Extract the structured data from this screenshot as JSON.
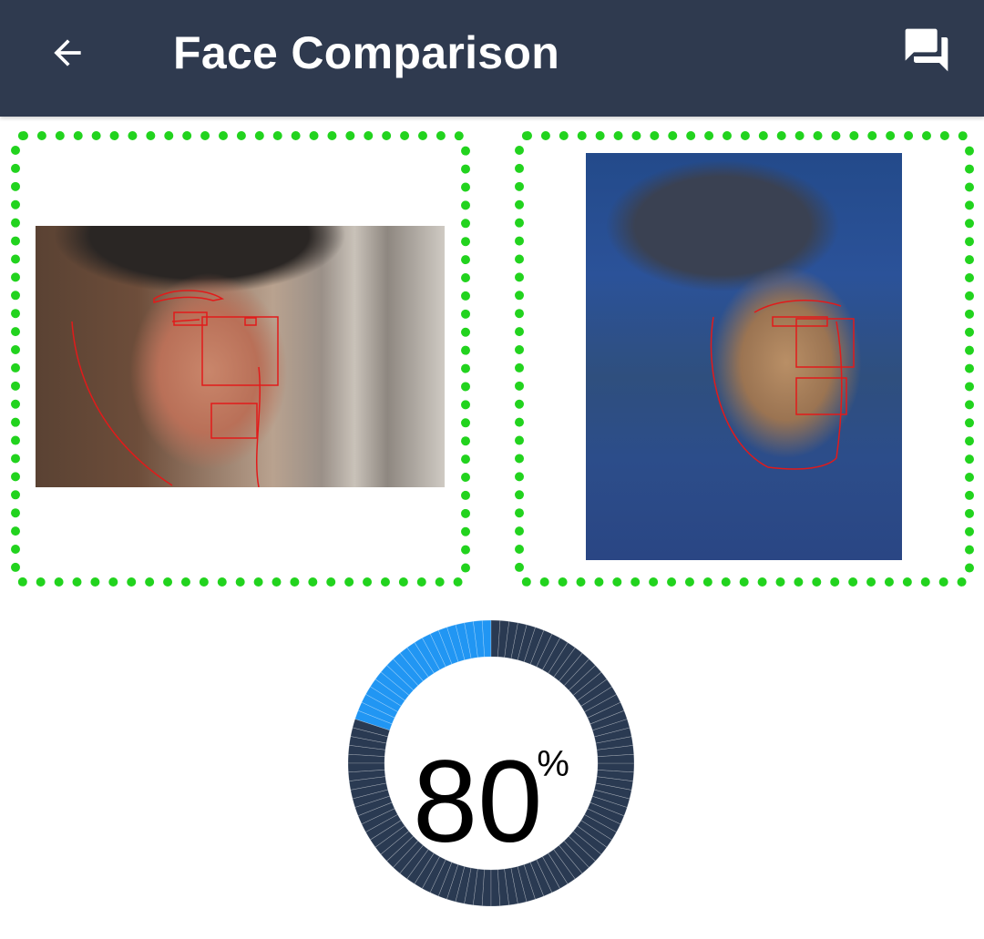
{
  "app_bar": {
    "title": "Face Comparison",
    "back_icon": "arrow-left-icon",
    "chat_icon": "question-answer-icon",
    "background_color": "#2f3a4f"
  },
  "faces": [
    {
      "name": "face-1",
      "frame_color": "#22d31e"
    },
    {
      "name": "face-2",
      "frame_color": "#22d31e"
    }
  ],
  "result": {
    "similarity_value": "80",
    "similarity_unit": "%",
    "similarity_fraction": 0.8,
    "gauge_colors": {
      "progress": "#2196f3",
      "remaining": "#2a3a52"
    }
  }
}
